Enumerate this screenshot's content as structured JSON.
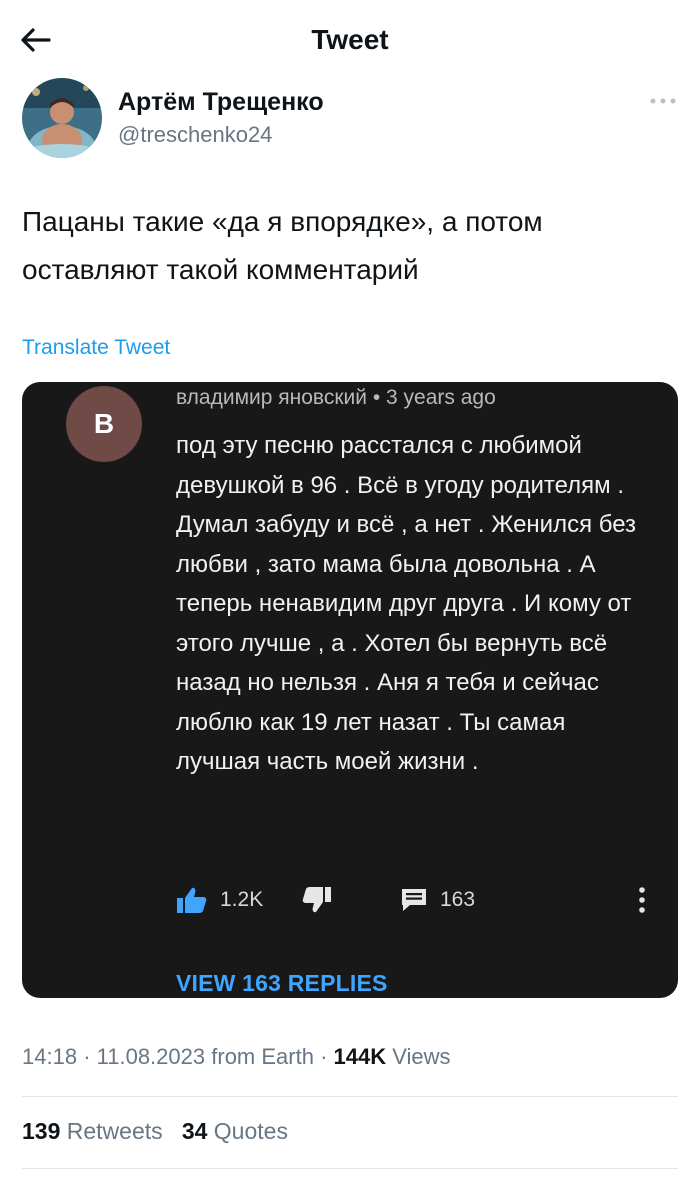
{
  "header": {
    "title": "Tweet",
    "back_icon": "arrow-left-icon"
  },
  "author": {
    "name": "Артём Трещенко",
    "handle": "@treschenko24",
    "avatar_icon": "user-photo-avatar"
  },
  "tweet": {
    "text": "Пацаны такие «да я впорядке», а потом оставляют такой комментарий",
    "translate_label": "Translate Tweet"
  },
  "media": {
    "commenter_initial": "B",
    "commenter_name": "владимир яновский",
    "time_ago": "3 years ago",
    "comment_text": "под эту песню расстался с любимой девушкой в 96 . Всё в угоду родителям .  Думал забуду и всё , а нет . Женился без любви , зато мама была довольна . А теперь ненавидим друг друга . И кому от этого лучше , а . Хотел бы вернуть всё назад но нельзя . Аня я тебя и сейчас люблю как 19 лет назат . Ты самая лучшая часть моей жизни .",
    "likes": "1.2K",
    "replies_count": "163",
    "view_replies_label": "VIEW 163 REPLIES",
    "avatar_color": "#6f4a47",
    "link_color": "#3ea6ff"
  },
  "meta": {
    "time": "14:18",
    "date": "11.08.2023",
    "source": "from Earth",
    "views_count": "144K",
    "views_label": "Views"
  },
  "stats": {
    "retweets_count": "139",
    "retweets_label": "Retweets",
    "quotes_count": "34",
    "quotes_label": "Quotes"
  },
  "colors": {
    "accent": "#1d9bf0",
    "secondary_text": "#687684",
    "primary_text": "#0f1419"
  }
}
